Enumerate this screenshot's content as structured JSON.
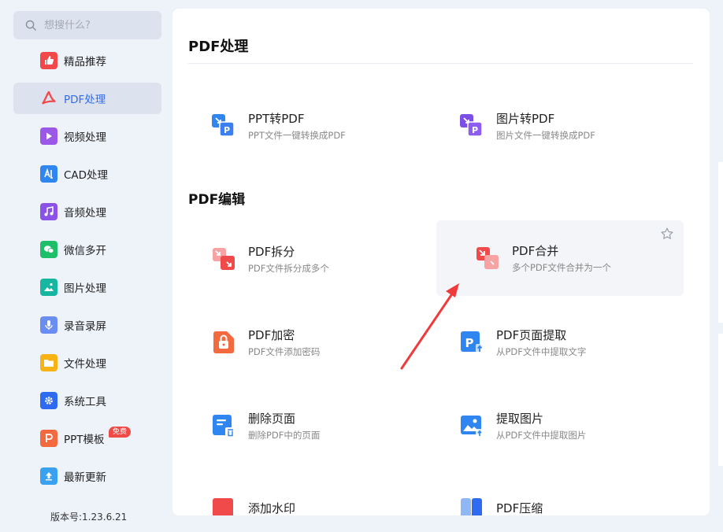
{
  "search": {
    "placeholder": "想搜什么?"
  },
  "sidebar": {
    "items": [
      {
        "label": "精品推荐",
        "icon": "thumbs-up-icon",
        "color": "#f0484b"
      },
      {
        "label": "PDF处理",
        "icon": "pdf-icon",
        "color": "#f0484b"
      },
      {
        "label": "视频处理",
        "icon": "play-icon",
        "color": "#9b58e8"
      },
      {
        "label": "CAD处理",
        "icon": "cad-icon",
        "color": "#2f86f0"
      },
      {
        "label": "音频处理",
        "icon": "music-icon",
        "color": "#8a52e6"
      },
      {
        "label": "微信多开",
        "icon": "wechat-icon",
        "color": "#1fbf6a"
      },
      {
        "label": "图片处理",
        "icon": "image-icon",
        "color": "#16b6a0"
      },
      {
        "label": "录音录屏",
        "icon": "mic-icon",
        "color": "#6a8df2"
      },
      {
        "label": "文件处理",
        "icon": "folder-icon",
        "color": "#f6b313"
      },
      {
        "label": "系统工具",
        "icon": "gear-icon",
        "color": "#2f6bf0"
      },
      {
        "label": "PPT模板",
        "icon": "ppt-icon",
        "color": "#f36a3f",
        "badge": "免费"
      },
      {
        "label": "最新更新",
        "icon": "upload-icon",
        "color": "#3aa0f0"
      }
    ]
  },
  "version": "版本号:1.23.6.21",
  "main": {
    "sections": [
      {
        "title": "PDF处理"
      },
      {
        "title": "PDF编辑"
      }
    ],
    "cards": [
      {
        "title": "PPT转PDF",
        "sub": "PPT文件一键转换成PDF",
        "icon": "ppt-to-pdf-icon"
      },
      {
        "title": "图片转PDF",
        "sub": "图片文件一键转换成PDF",
        "icon": "image-to-pdf-icon"
      },
      {
        "title": "PDF拆分",
        "sub": "PDF文件拆分成多个",
        "icon": "pdf-split-icon"
      },
      {
        "title": "PDF合并",
        "sub": "多个PDF文件合并为一个",
        "icon": "pdf-merge-icon"
      },
      {
        "title": "PDF加密",
        "sub": "PDF文件添加密码",
        "icon": "pdf-lock-icon"
      },
      {
        "title": "PDF页面提取",
        "sub": "从PDF文件中提取文字",
        "icon": "pdf-page-extract-icon"
      },
      {
        "title": "删除页面",
        "sub": "删除PDF中的页面",
        "icon": "delete-page-icon"
      },
      {
        "title": "提取图片",
        "sub": "从PDF文件中提取图片",
        "icon": "extract-image-icon"
      },
      {
        "title": "添加水印",
        "sub": "",
        "icon": "watermark-icon"
      },
      {
        "title": "PDF压缩",
        "sub": "",
        "icon": "pdf-compress-icon"
      }
    ]
  },
  "colors": {
    "accent": "#2f6bf0",
    "annotation_arrow": "#ef3b3b"
  }
}
